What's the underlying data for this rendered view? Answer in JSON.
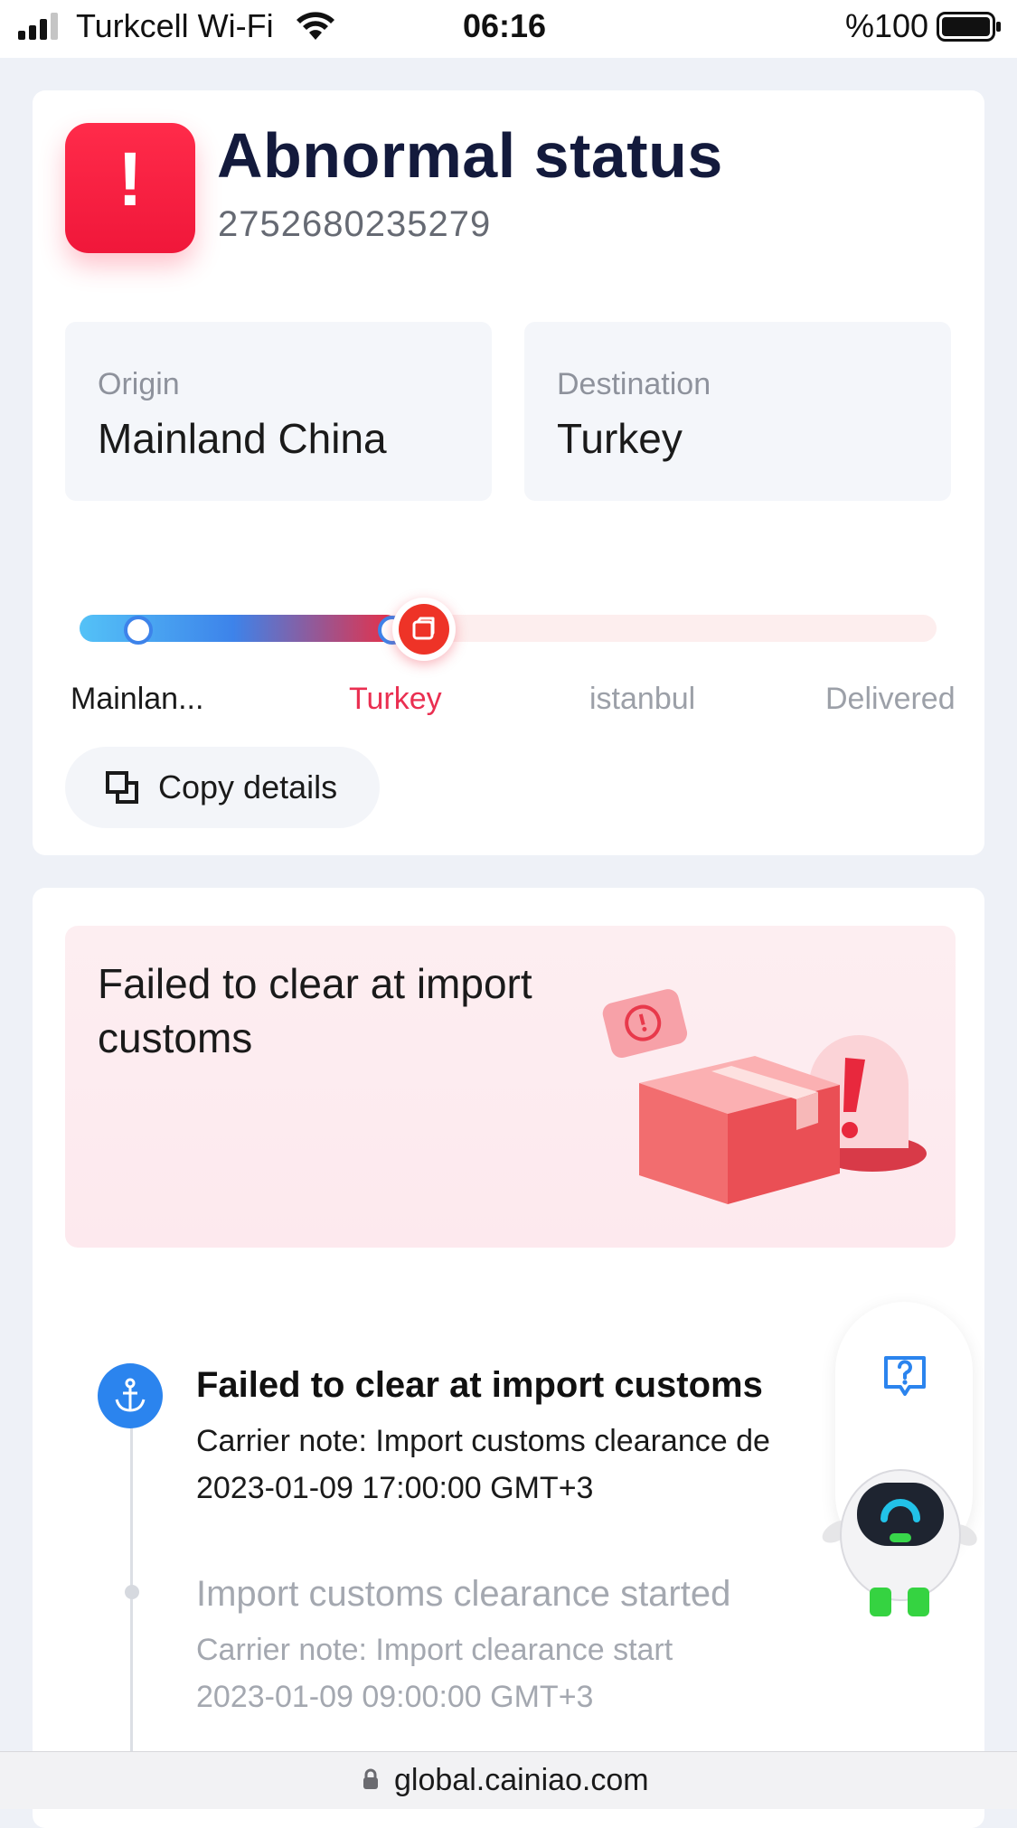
{
  "status_bar": {
    "carrier": "Turkcell Wi-Fi",
    "time": "06:16",
    "battery": "%100"
  },
  "shipment": {
    "status_title": "Abnormal status",
    "status_icon": "exclamation-icon",
    "tracking_number": "2752680235279",
    "origin_label": "Origin",
    "origin_value": "Mainland China",
    "destination_label": "Destination",
    "destination_value": "Turkey"
  },
  "progress": {
    "current_stage_index": 1,
    "stages": [
      "Mainlan...",
      "Turkey",
      "istanbul",
      "Delivered"
    ]
  },
  "copy_button": {
    "label": "Copy details",
    "icon": "copy-icon"
  },
  "exception": {
    "message": "Failed to clear at import customs"
  },
  "timeline": [
    {
      "title": "Failed to clear at import customs",
      "note": "Carrier note: Import customs clearance de",
      "time": "2023-01-09 17:00:00 GMT+3",
      "icon": "anchor-icon"
    },
    {
      "title": "Import customs clearance started",
      "note": "Carrier note: Import clearance start",
      "time": "2023-01-09 09:00:00 GMT+3"
    }
  ],
  "help": {
    "icon": "question-chat-icon"
  },
  "browser": {
    "url": "global.cainiao.com"
  },
  "colors": {
    "alert_red": "#f0173a",
    "accent_blue": "#2b84ee",
    "current_stage_pink": "#ea2f51",
    "title_navy": "#131a3c"
  }
}
